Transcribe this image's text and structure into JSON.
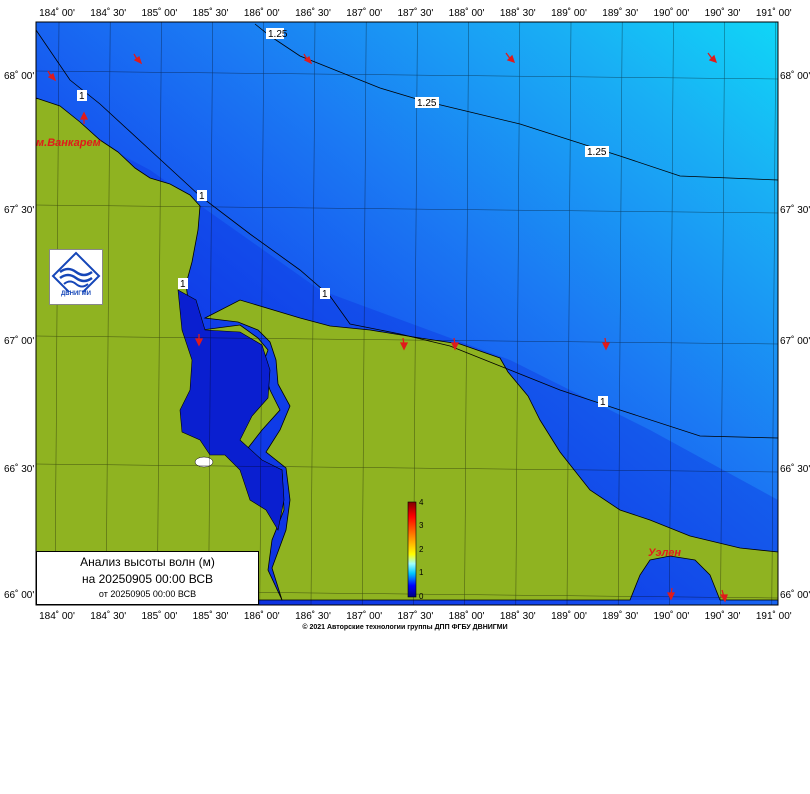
{
  "map": {
    "lon_ticks": [
      "184˚ 00'",
      "184˚ 30'",
      "185˚ 00'",
      "185˚ 30'",
      "186˚ 00'",
      "186˚ 30'",
      "187˚ 00'",
      "187˚ 30'",
      "188˚ 00'",
      "188˚ 30'",
      "189˚ 00'",
      "189˚ 30'",
      "190˚ 00'",
      "190˚ 30'",
      "191˚ 00'"
    ],
    "lat_ticks": [
      "68˚ 00'",
      "67˚ 30'",
      "67˚ 00'",
      "66˚ 30'",
      "66˚ 00'"
    ],
    "contour_labels": [
      "1.25",
      "1.25",
      "1.25",
      "1",
      "1",
      "1",
      "1",
      "1"
    ],
    "places": [
      "м.Ванкарем",
      "Уэлен"
    ],
    "colorbar_ticks": [
      "4",
      "3",
      "2",
      "1",
      "0"
    ],
    "copyright": "© 2021 Авторские технологии группы ДПП ФГБУ ДВНИГМИ",
    "colors": {
      "land": "#8fb321",
      "sea_deep": "#0a1fd0",
      "sea_mid": "#1d57f0",
      "sea_light": "#18b8f4",
      "arrow": "#e01b1b"
    }
  },
  "logo": {
    "text": "ДВНИГМИ",
    "icon": "dvnigmi-wave-logo-icon"
  },
  "info": {
    "title": "Анализ высоты волн (м)",
    "date_line": "на 20250905 00:00 ВСВ",
    "from_line": "от 20250905 00:00 ВСВ"
  }
}
